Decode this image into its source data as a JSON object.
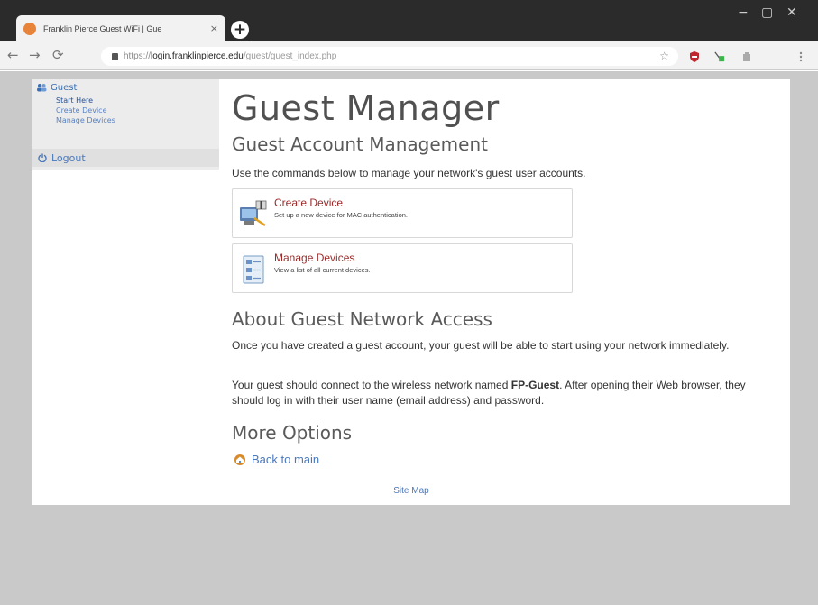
{
  "browser": {
    "tab_title": "Franklin Pierce Guest WiFi | Gue",
    "tab_close": "×",
    "new_tab": "+",
    "win_minimize": "−",
    "win_maximize": "▢",
    "win_close": "✕",
    "back": "←",
    "forward": "→",
    "reload": "⟳",
    "url_prefix": "https://",
    "url_host": "login.franklinpierce.edu",
    "url_path": "/guest/guest_index.php",
    "star": "☆"
  },
  "sidebar": {
    "section_label": "Guest",
    "items": [
      {
        "label": "Start Here"
      },
      {
        "label": "Create Device"
      },
      {
        "label": "Manage Devices"
      }
    ],
    "logout_label": "Logout"
  },
  "main": {
    "title": "Guest Manager",
    "subtitle": "Guest Account Management",
    "intro": "Use the commands below to manage your network's guest user accounts.",
    "commands": [
      {
        "title": "Create Device",
        "desc": "Set up a new device for MAC authentication."
      },
      {
        "title": "Manage Devices",
        "desc": "View a list of all current devices."
      }
    ],
    "about_heading": "About Guest Network Access",
    "about_p1": "Once you have created a guest account, your guest will be able to start using your network immediately.",
    "about_p2_before": "Your guest should connect to the wireless network named ",
    "about_p2_network": "FP-Guest",
    "about_p2_after": ". After opening their Web browser, they should log in with their user name (email address) and password.",
    "more_heading": "More Options",
    "back_link": "Back to main",
    "sitemap": "Site Map"
  },
  "colors": {
    "link": "#4a78bb",
    "command_title": "#9b2a2a",
    "titlebar": "#2b2b2b"
  }
}
